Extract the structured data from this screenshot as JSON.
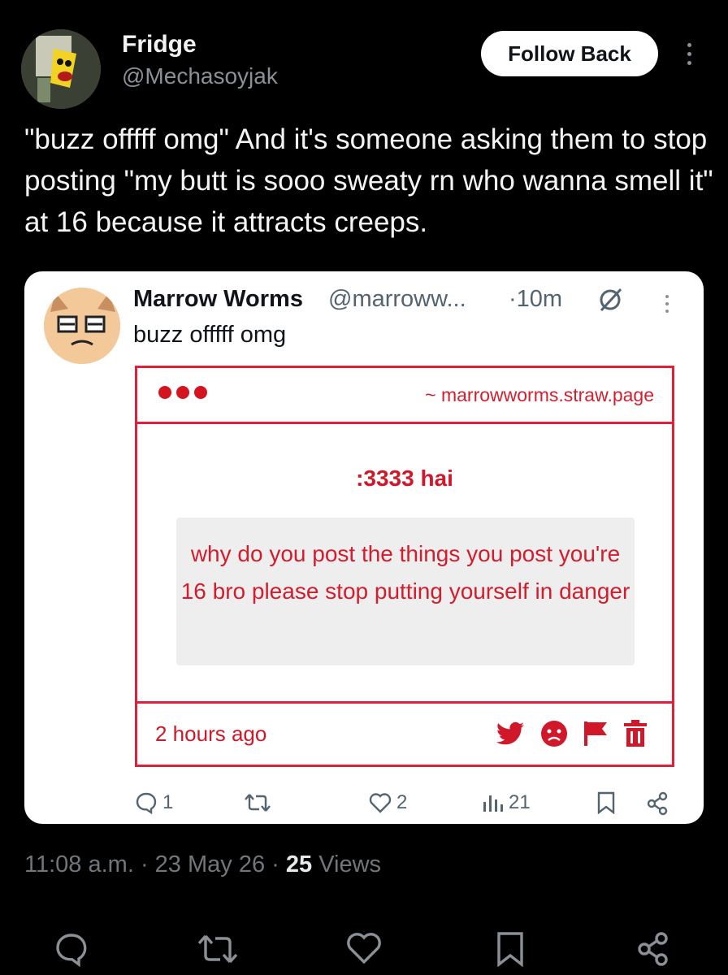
{
  "author": {
    "name": "Fridge",
    "handle": "@Mechasoyjak",
    "follow_label": "Follow Back"
  },
  "post": {
    "text": "\"buzz offfff omg\" And it's someone asking them to stop posting \"my butt is sooo sweaty rn who wanna smell it\" at 16 because it attracts creeps."
  },
  "quoted": {
    "name": "Marrow Worms",
    "handle": "@marroww...",
    "time": "·10m",
    "text": "buzz offfff omg",
    "embed": {
      "url": "~ marrowworms.straw.page",
      "greeting": ":3333 hai",
      "message": "why do you post the things you post you're 16 bro please stop putting yourself in danger",
      "timestamp": "2 hours ago"
    },
    "metrics": {
      "replies": "1",
      "likes": "2",
      "views": "21"
    }
  },
  "meta": {
    "time": "11:08 a.m.",
    "date": "· 23 May 26 ·",
    "views_count": "25",
    "views_label": "Views"
  },
  "colors": {
    "accent_red": "#e0203a",
    "follow_bg": "#ffffff",
    "muted": "#71767b"
  },
  "icons": [
    "reply-icon",
    "retweet-icon",
    "like-icon",
    "bookmark-icon",
    "share-icon",
    "views-icon",
    "twitter-bird-icon",
    "angry-face-icon",
    "flag-icon",
    "trash-icon",
    "no-interaction-icon"
  ]
}
